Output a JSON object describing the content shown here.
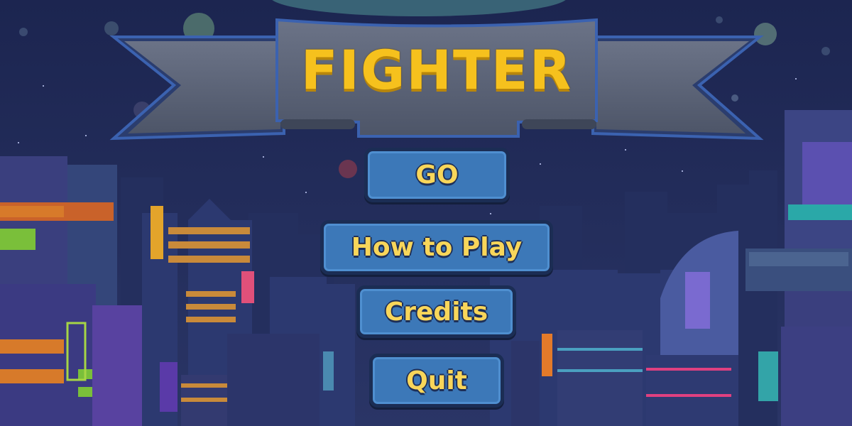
{
  "game": {
    "title": "FIGHTER"
  },
  "menu": {
    "go_label": "GO",
    "how_to_play_label": "How to Play",
    "credits_label": "Credits",
    "quit_label": "Quit"
  },
  "colors": {
    "sky": "#1f2a52",
    "title_yellow": "#f6c11d",
    "button_blue": "#3c78b8",
    "button_text": "#f8d65a",
    "banner_gray": "#5a6478"
  }
}
